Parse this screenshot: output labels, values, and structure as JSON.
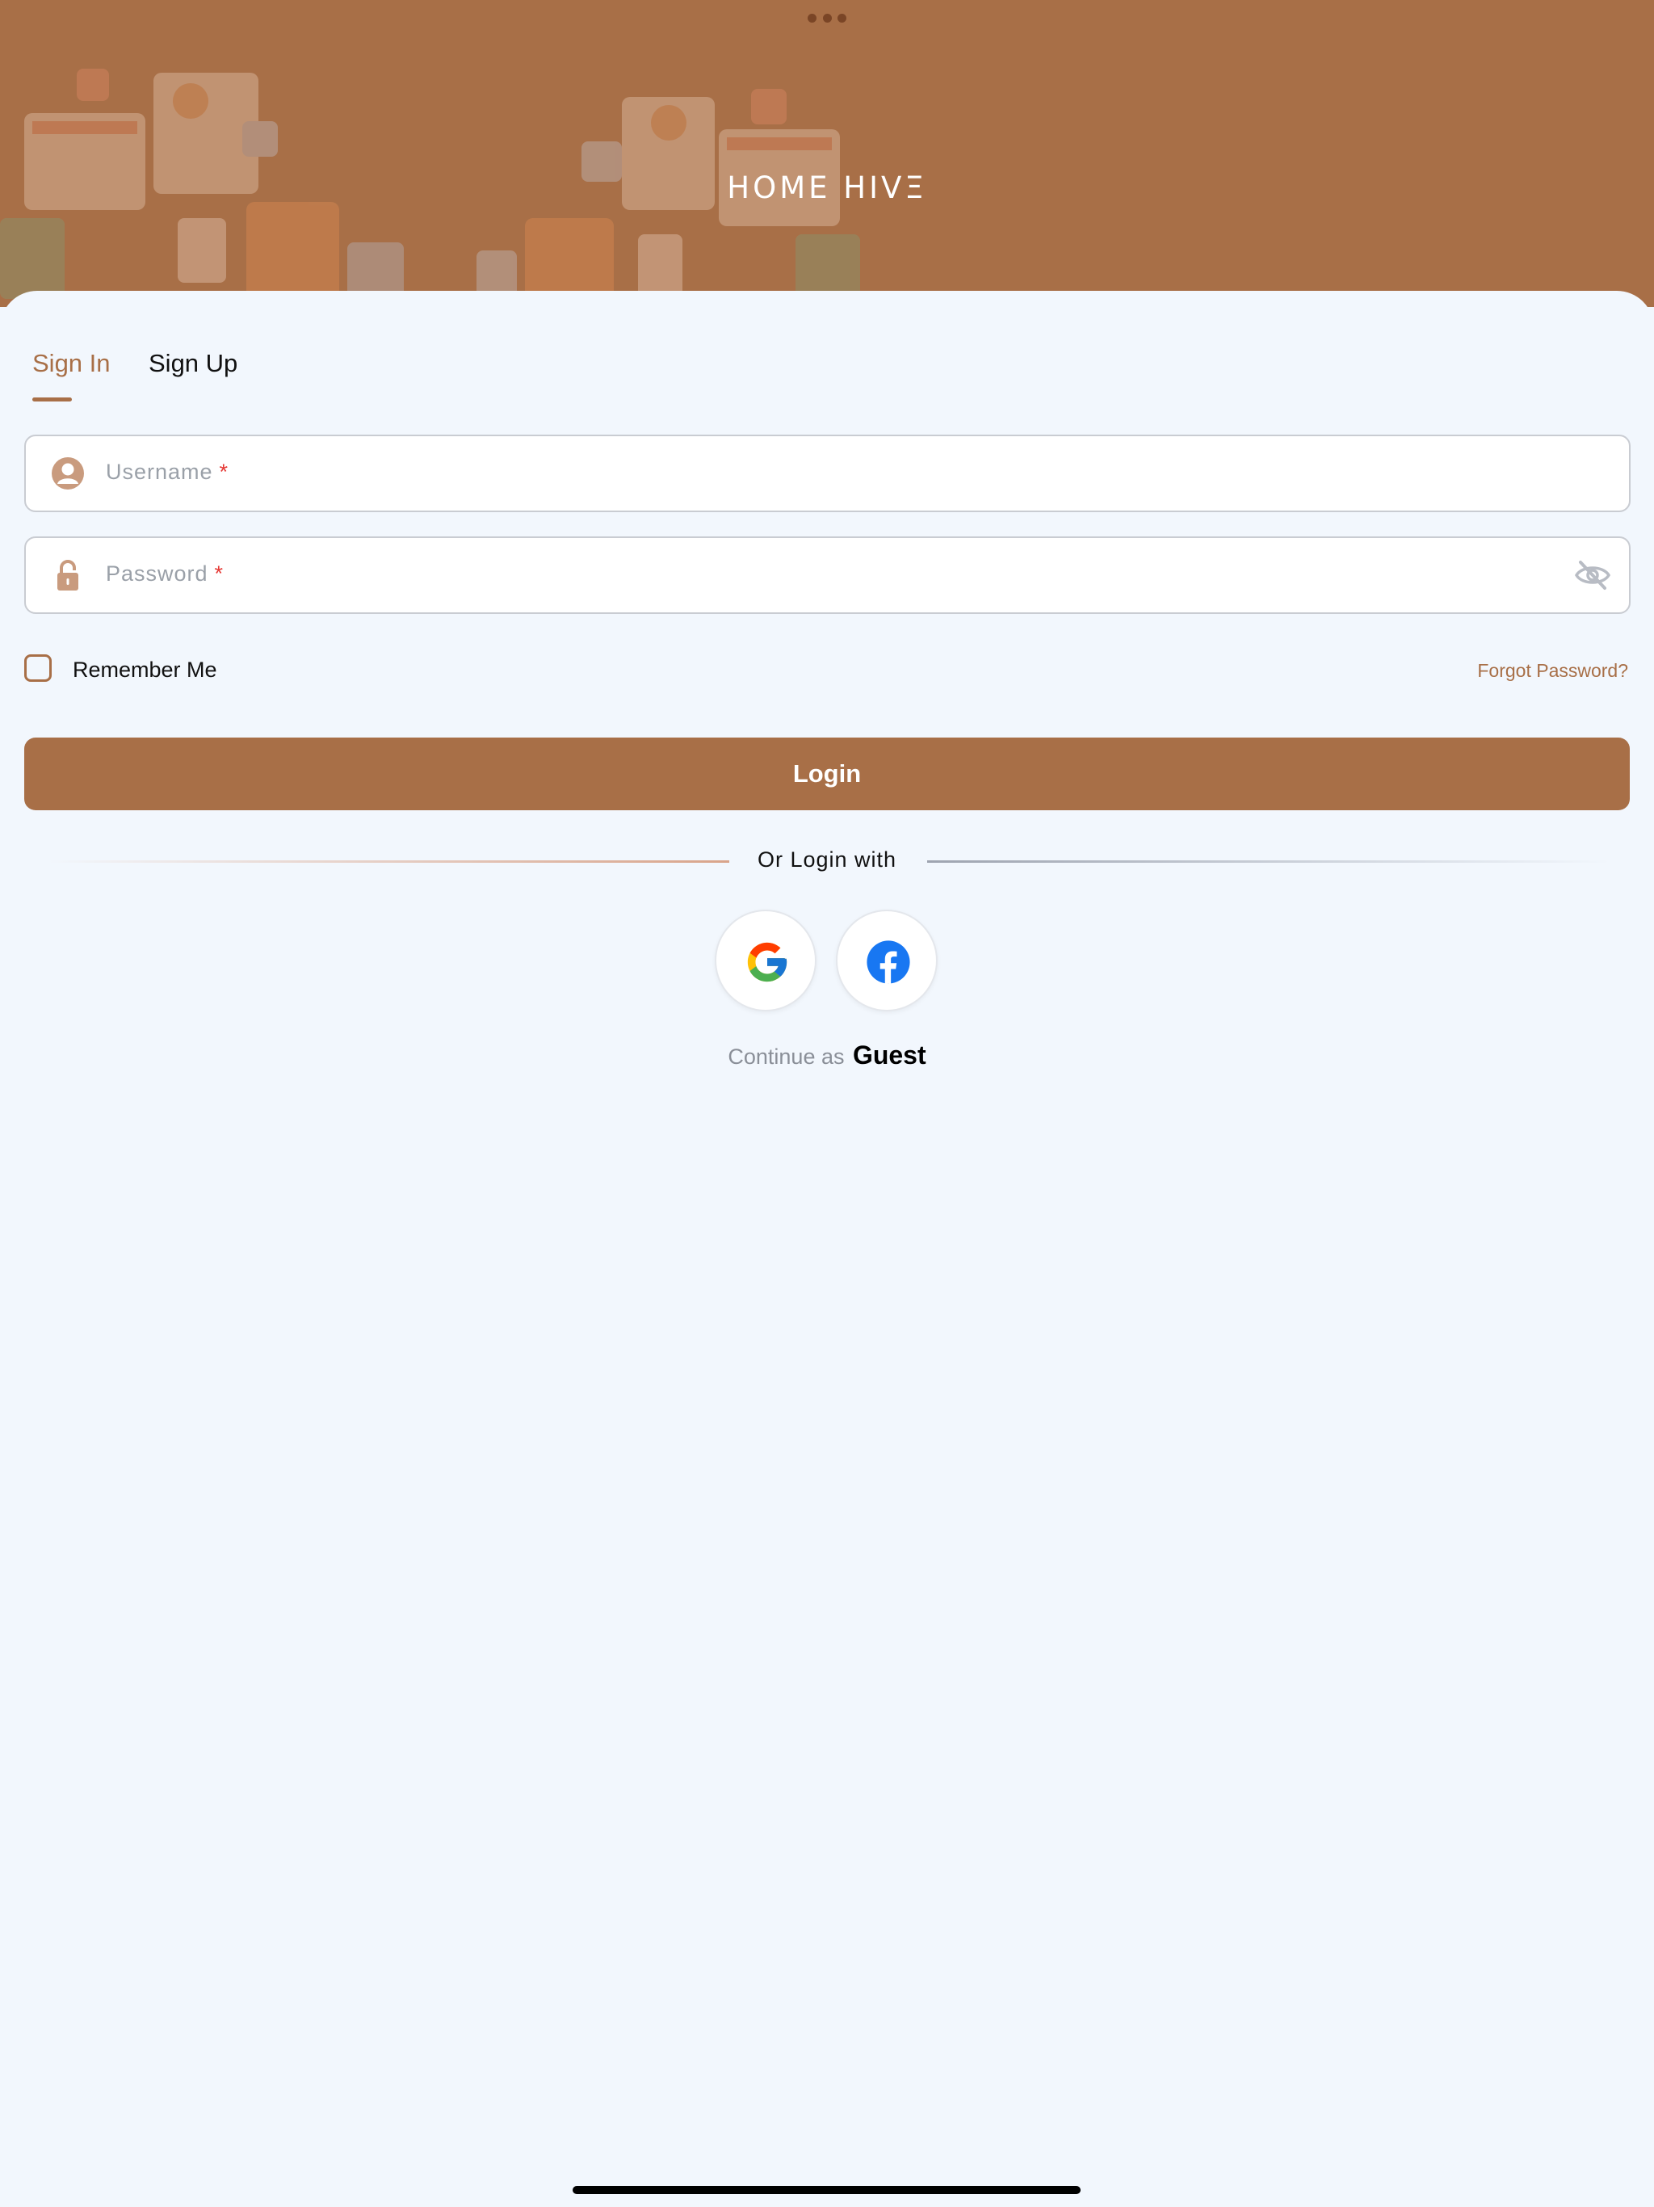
{
  "app": {
    "logo_text": "HOME HIVΞ",
    "brand_color": "#a86f47"
  },
  "tabs": {
    "sign_in": "Sign In",
    "sign_up": "Sign Up",
    "active": "Sign In"
  },
  "form": {
    "username": {
      "placeholder": "Username",
      "required_mark": "*",
      "icon": "user-avatar-icon",
      "value": ""
    },
    "password": {
      "placeholder": "Password",
      "required_mark": "*",
      "icon": "lock-icon",
      "visibility_icon": "eye-off-icon",
      "value": ""
    },
    "remember_me": {
      "label": "Remember Me",
      "checked": false
    },
    "forgot_password": "Forgot Password?",
    "login_button": "Login"
  },
  "social": {
    "divider_text": "Or Login with",
    "providers": [
      "google-icon",
      "facebook-icon"
    ]
  },
  "guest": {
    "prefix": "Continue as",
    "link": "Guest"
  }
}
